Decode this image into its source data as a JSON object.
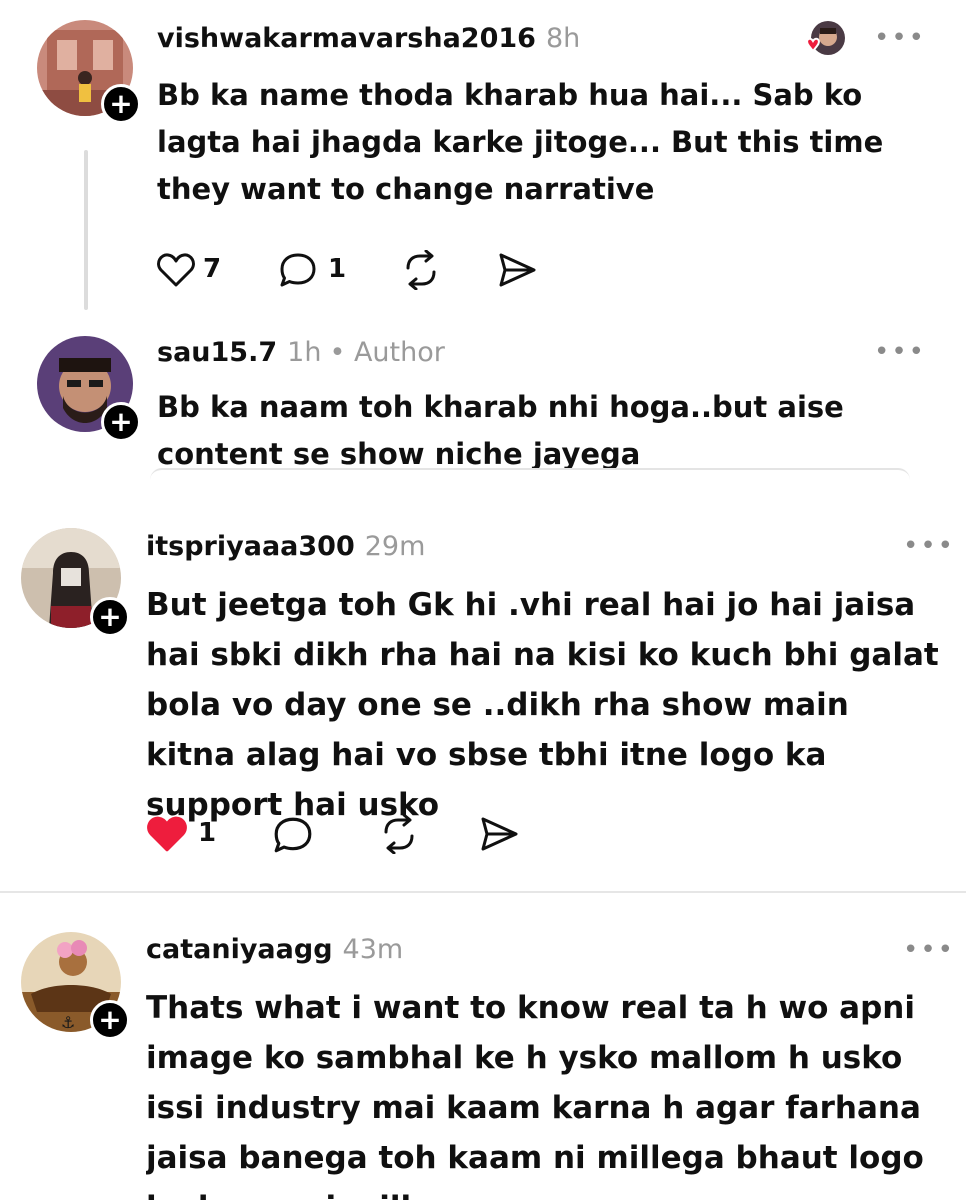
{
  "posts": [
    {
      "username": "vishwakarmavarsha2016",
      "time": "8h",
      "text": "Bb ka name thoda kharab hua hai... Sab ko lagta hai jhagda karke jitoge... But this time they want to change narrative",
      "likes": "7",
      "replies": "1",
      "liked": false
    },
    {
      "username": "sau15.7",
      "time": "1h",
      "author_badge": "• Author",
      "text": "Bb ka naam toh kharab nhi hoga..but aise content se show niche jayega"
    },
    {
      "username": "itspriyaaa300",
      "time": "29m",
      "text": "But jeetga toh Gk hi .vhi real hai jo hai jaisa hai sbki dikh rha hai na kisi ko kuch bhi galat bola vo day one se ..dikh rha show main kitna alag hai vo sbse tbhi itne logo ka support hai usko",
      "likes": "1",
      "liked": true
    },
    {
      "username": "cataniyaagg",
      "time": "43m",
      "text": "Thats what i want to know real ta h wo apni image ko sambhal ke h ysko mallom h usko issi industry mai kaam karna h agar farhana jaisa banega toh kaam ni millega bhaut logo ko kaam ni milla"
    }
  ],
  "icons": {
    "more": "ellipsis-icon",
    "like": "heart-icon",
    "reply": "comment-bubble-icon",
    "repost": "repost-icon",
    "share": "send-icon",
    "follow": "plus-icon"
  },
  "more_glyph": "•••",
  "follow_glyph": "+",
  "colors": {
    "liked": "#ee1d3d",
    "meta": "#9a9a9a",
    "text": "#101010"
  }
}
